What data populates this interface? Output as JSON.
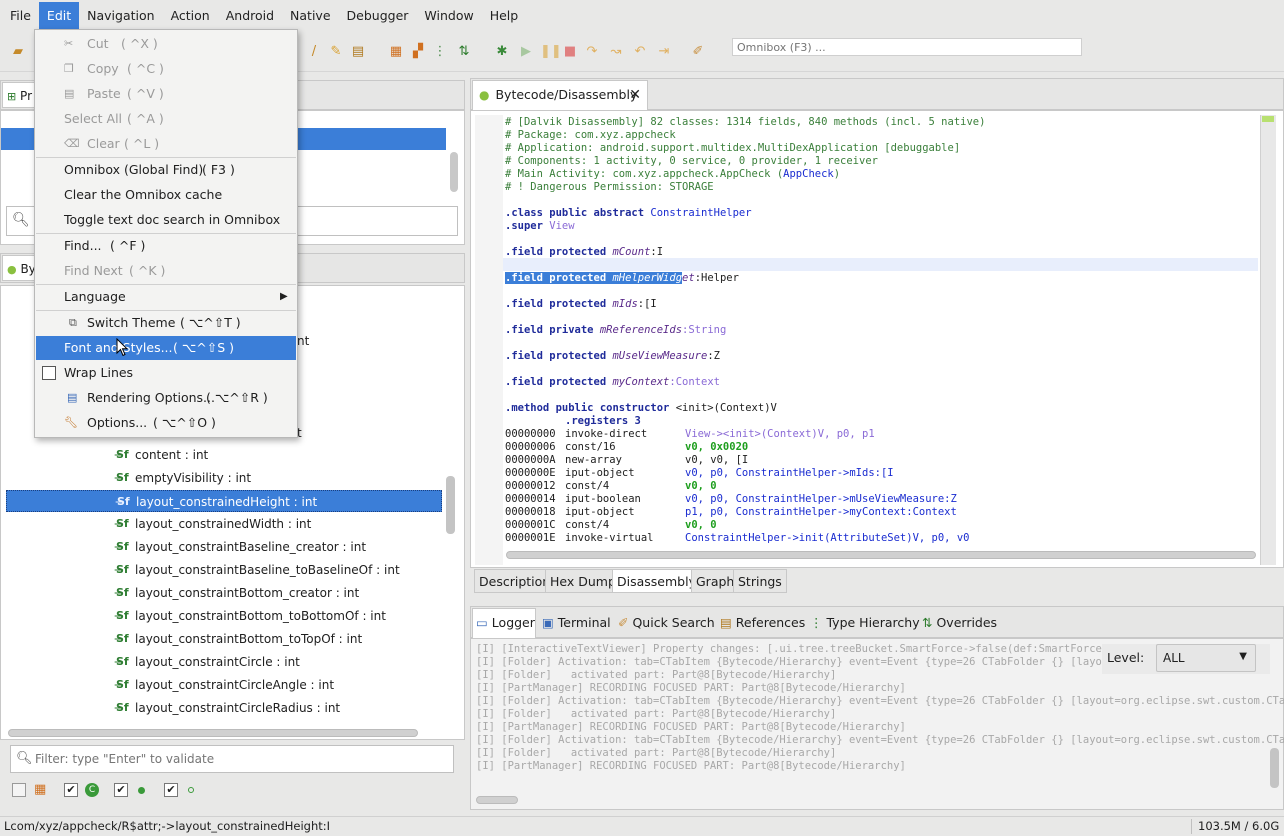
{
  "menubar": {
    "items": [
      "File",
      "Edit",
      "Navigation",
      "Action",
      "Android",
      "Native",
      "Debugger",
      "Window",
      "Help"
    ],
    "active": "Edit"
  },
  "toolbar": {
    "omnibox_placeholder": "Omnibox (F3) ..."
  },
  "edit_menu": {
    "items": [
      {
        "label": "Cut",
        "shortcut": "( ^X )",
        "disabled": true,
        "icon": "cut-icon"
      },
      {
        "label": "Copy",
        "shortcut": "( ^C )",
        "disabled": true,
        "icon": "copy-icon"
      },
      {
        "label": "Paste",
        "shortcut": "( ^V )",
        "disabled": true,
        "icon": "paste-icon"
      },
      {
        "label": "Select All",
        "shortcut": "( ^A )",
        "disabled": true
      },
      {
        "label": "Clear",
        "shortcut": "( ^L )",
        "disabled": true,
        "icon": "clear-icon"
      },
      {
        "label": "Omnibox (Global Find)",
        "shortcut": "( F3 )",
        "disabled": false
      },
      {
        "label": "Clear the Omnibox cache",
        "shortcut": "",
        "disabled": false
      },
      {
        "label": "Toggle text doc search in Omnibox",
        "shortcut": "",
        "disabled": false
      },
      {
        "label": "Find...",
        "shortcut": "( ^F )",
        "disabled": false
      },
      {
        "label": "Find Next",
        "shortcut": "( ^K )",
        "disabled": true
      },
      {
        "label": "Language",
        "shortcut": "",
        "disabled": false,
        "submenu": true
      },
      {
        "label": "Switch Theme",
        "shortcut": "( ⌥^⇧T )",
        "disabled": false,
        "icon": "theme-icon"
      },
      {
        "label": "Font and Styles...",
        "shortcut": "( ⌥^⇧S )",
        "disabled": false,
        "highlighted": true
      },
      {
        "label": "Wrap Lines",
        "shortcut": "",
        "disabled": false,
        "checkbox": true,
        "checked": false
      },
      {
        "label": "Rendering Options...",
        "shortcut": "( ⌥^⇧R )",
        "disabled": false,
        "icon": "rendering-icon"
      },
      {
        "label": "Options...",
        "shortcut": "( ⌥^⇧O )",
        "disabled": false,
        "icon": "wrench-icon"
      }
    ]
  },
  "left_top": {
    "tab_label": "Pr"
  },
  "left_bottom": {
    "tab_label": "By",
    "partial_rows": [
      "nt",
      "t"
    ],
    "rows": [
      {
        "label": "content : int",
        "selected": false
      },
      {
        "label": "emptyVisibility : int",
        "selected": false
      },
      {
        "label": "layout_constrainedHeight : int",
        "selected": true
      },
      {
        "label": "layout_constrainedWidth : int",
        "selected": false
      },
      {
        "label": "layout_constraintBaseline_creator : int",
        "selected": false
      },
      {
        "label": "layout_constraintBaseline_toBaselineOf : int",
        "selected": false
      },
      {
        "label": "layout_constraintBottom_creator : int",
        "selected": false
      },
      {
        "label": "layout_constraintBottom_toBottomOf : int",
        "selected": false
      },
      {
        "label": "layout_constraintBottom_toTopOf : int",
        "selected": false
      },
      {
        "label": "layout_constraintCircle : int",
        "selected": false
      },
      {
        "label": "layout_constraintCircleAngle : int",
        "selected": false
      },
      {
        "label": "layout_constraintCircleRadius : int",
        "selected": false
      }
    ],
    "filter_placeholder": "Filter: type \"Enter\" to validate"
  },
  "editor": {
    "tab_label": "Bytecode/Disassembly",
    "header_comments": [
      "# [Dalvik Disassembly] 82 classes: 1314 fields, 840 methods (incl. 5 native)",
      "# Package: com.xyz.appcheck",
      "# Application: android.support.multidex.MultiDexApplication [debuggable]",
      "# Components: 1 activity, 0 service, 0 provider, 1 receiver",
      "# Main Activity: com.xyz.appcheck.AppCheck (",
      "# ! Dangerous Permission: STORAGE"
    ],
    "main_activity_link": "AppCheck",
    "class_decl": {
      "kw": ".class public abstract",
      "name": "ConstraintHelper"
    },
    "super_decl": {
      "kw": ".super",
      "name": "View"
    },
    "fields": [
      {
        "kw": ".field protected",
        "name": "mCount",
        "type": ":I",
        "highlighted": false
      },
      {
        "kw": ".field protected",
        "name": "mHelperWidget",
        "type": ":Helper",
        "highlighted": true
      },
      {
        "kw": ".field protected",
        "name": "mIds",
        "type": ":[I",
        "highlighted": false
      },
      {
        "kw": ".field private",
        "name": "mReferenceIds",
        "type": ":String",
        "highlighted": false
      },
      {
        "kw": ".field protected",
        "name": "mUseViewMeasure",
        "type": ":Z",
        "highlighted": false
      },
      {
        "kw": ".field protected",
        "name": "myContext",
        "type": ":Context",
        "highlighted": false
      }
    ],
    "method_decl": ".method public constructor",
    "method_sig": "<init>(Context)V",
    "registers": ".registers 3",
    "instructions": [
      {
        "addr": "00000000",
        "op": "invoke-direct",
        "args": "View-><init>(Context)V, p0, p1"
      },
      {
        "addr": "00000006",
        "op": "const/16",
        "args": "v0, 0x0020"
      },
      {
        "addr": "0000000A",
        "op": "new-array",
        "args": "v0, v0, [I"
      },
      {
        "addr": "0000000E",
        "op": "iput-object",
        "args": "v0, p0, ConstraintHelper->mIds:[I"
      },
      {
        "addr": "00000012",
        "op": "const/4",
        "args": "v0, 0"
      },
      {
        "addr": "00000014",
        "op": "iput-boolean",
        "args": "v0, p0, ConstraintHelper->mUseViewMeasure:Z"
      },
      {
        "addr": "00000018",
        "op": "iput-object",
        "args": "p1, p0, ConstraintHelper->myContext:Context"
      },
      {
        "addr": "0000001C",
        "op": "const/4",
        "args": "v0, 0"
      },
      {
        "addr": "0000001E",
        "op": "invoke-virtual",
        "args": "ConstraintHelper->init(AttributeSet)V, p0, v0"
      }
    ],
    "bottom_tabs": [
      "Description",
      "Hex Dump",
      "Disassembly",
      "Graph",
      "Strings"
    ],
    "active_bottom_tab": "Disassembly"
  },
  "logger": {
    "tabs": [
      "Logger",
      "Terminal",
      "Quick Search",
      "References",
      "Type Hierarchy",
      "Overrides"
    ],
    "level_label": "Level:",
    "level_value": "ALL",
    "lines": [
      "[I] [InteractiveTextViewer] Property changes: [.ui.tree.treeBucket.SmartForce->false(def:SmartForce(Boole",
      "[I] [Folder] Activation: tab=CTabItem {Bytecode/Hierarchy} event=Event {type=26 CTabFolder {} [layout=org",
      "[I] [Folder]   activated part: Part@8[Bytecode/Hierarchy]",
      "[I] [PartManager] RECORDING FOCUSED PART: Part@8[Bytecode/Hierarchy]",
      "[I] [Folder] Activation: tab=CTabItem {Bytecode/Hierarchy} event=Event {type=26 CTabFolder {} [layout=org.eclipse.swt.custom.CTabFol",
      "[I] [Folder]   activated part: Part@8[Bytecode/Hierarchy]",
      "[I] [PartManager] RECORDING FOCUSED PART: Part@8[Bytecode/Hierarchy]",
      "[I] [Folder] Activation: tab=CTabItem {Bytecode/Hierarchy} event=Event {type=26 CTabFolder {} [layout=org.eclipse.swt.custom.CTabFol",
      "[I] [Folder]   activated part: Part@8[Bytecode/Hierarchy]",
      "[I] [PartManager] RECORDING FOCUSED PART: Part@8[Bytecode/Hierarchy]"
    ]
  },
  "status": {
    "path": "Lcom/xyz/appcheck/R$attr;->layout_constrainedHeight:I",
    "memory": "103.5M / 6.0G"
  },
  "colors": {
    "accent": "#3b7ed8",
    "comment": "#3a7f3a",
    "keyword": "#1f2b9a",
    "type": "#8a6ad6",
    "number": "#1e9e1e"
  }
}
